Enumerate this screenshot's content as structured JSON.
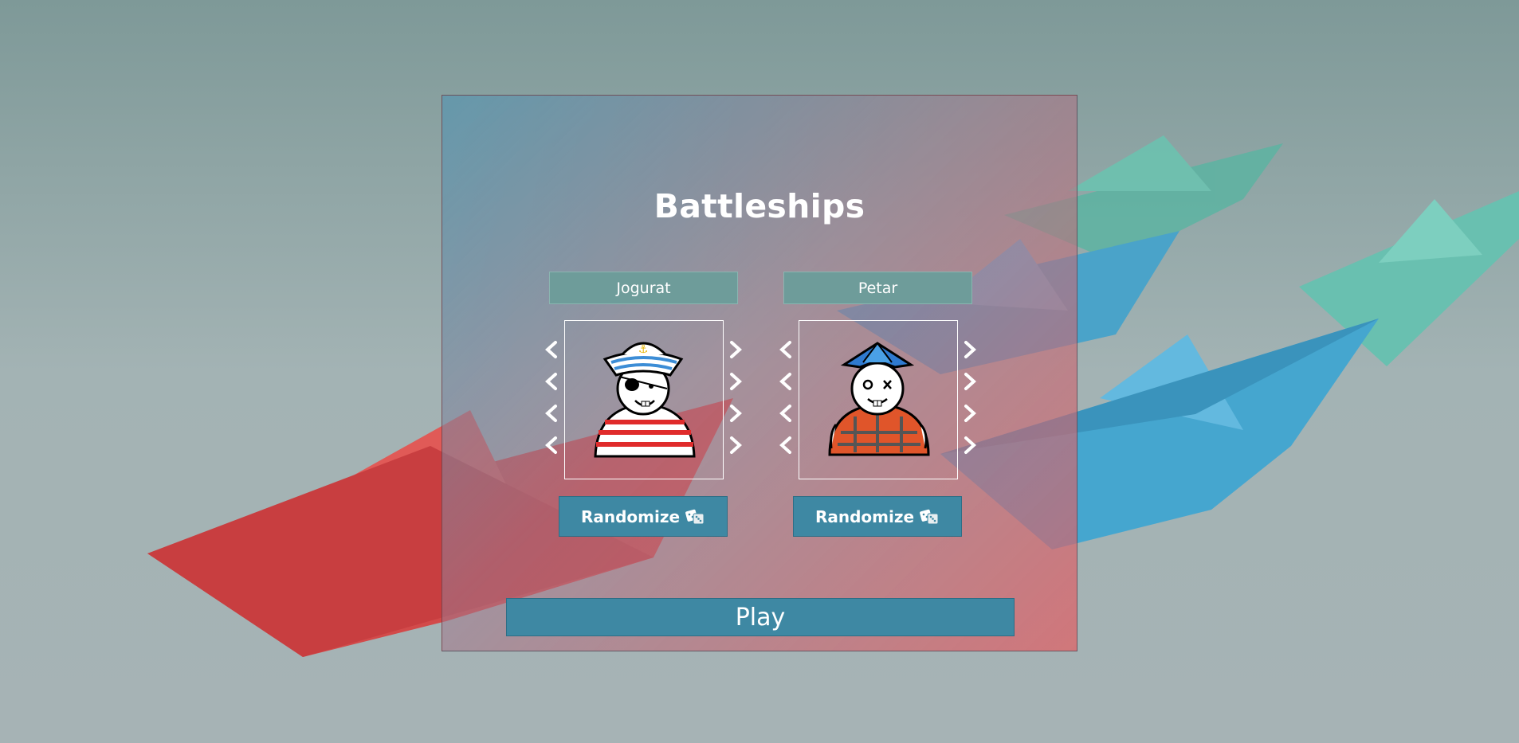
{
  "title": "Battleships",
  "players": [
    {
      "name": "Jogurat",
      "randomize_label": "Randomize"
    },
    {
      "name": "Petar",
      "randomize_label": "Randomize"
    }
  ],
  "play_label": "Play",
  "icons": {
    "left_arrow": "chevron-left-icon",
    "right_arrow": "chevron-right-icon",
    "dice": "dice-icon"
  },
  "colors": {
    "button": "#3e88a3",
    "name_field": "#6e9c9a"
  }
}
